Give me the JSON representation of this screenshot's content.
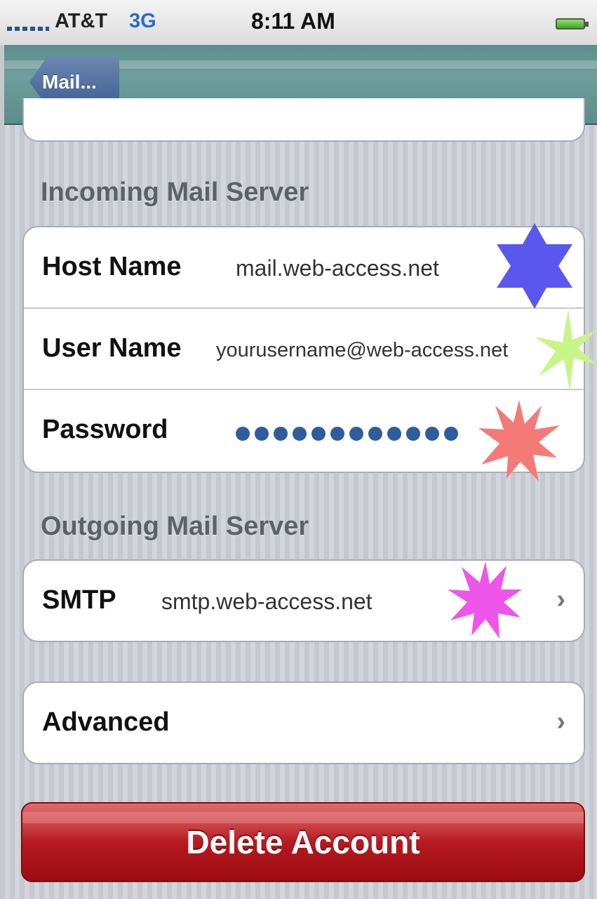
{
  "status_bar": {
    "carrier": "AT&T",
    "network": "3G",
    "time": "8:11 AM"
  },
  "nav": {
    "back_label": "Mail..."
  },
  "incoming": {
    "header": "Incoming Mail Server",
    "rows": [
      {
        "label": "Host Name",
        "value": "mail.web-access.net"
      },
      {
        "label": "User Name",
        "value": "yourusername@web-access.net"
      },
      {
        "label": "Password",
        "value": "••••••••••••••"
      }
    ]
  },
  "outgoing": {
    "header": "Outgoing Mail Server",
    "smtp_label": "SMTP",
    "smtp_value": "smtp.web-access.net"
  },
  "advanced_label": "Advanced",
  "delete_label": "Delete Account",
  "colors": {
    "star_blue": "#5a57ef",
    "star_green": "#c8f58a",
    "star_red": "#f47a78",
    "star_magenta": "#ee55e9",
    "nav_teal": "#6a9a98",
    "delete_red": "#b51a20"
  }
}
